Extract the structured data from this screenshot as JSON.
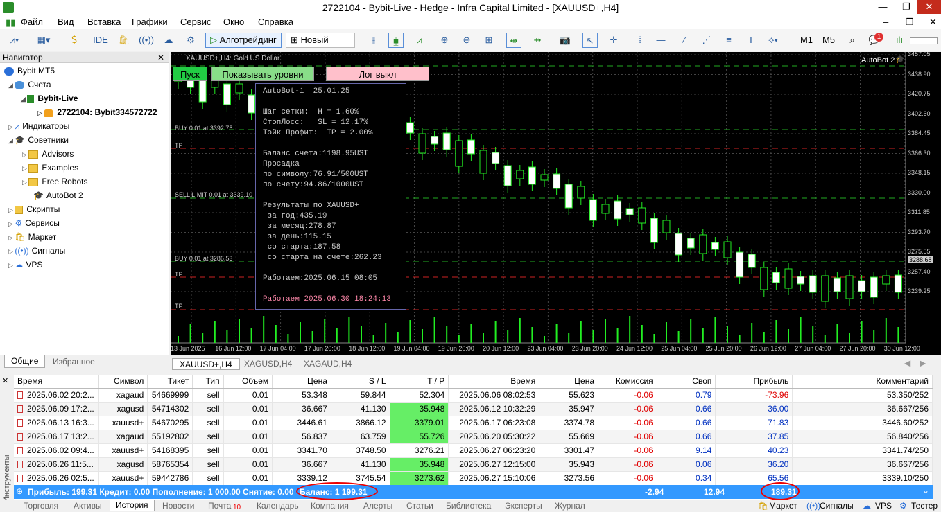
{
  "app": {
    "title": "2722104 - Bybit-Live - Hedge - Infra Capital Limited - [XAUUSD+,H4]"
  },
  "menu": [
    "Файл",
    "Вид",
    "Вставка",
    "Графики",
    "Сервис",
    "Окно",
    "Справка"
  ],
  "toolbar": {
    "ide": "IDE",
    "algo": "Алготрейдинг",
    "new_order": "Новый ордер",
    "m1": "M1",
    "m5": "M5",
    "notif_count": "1"
  },
  "navigator": {
    "title": "Навигатор",
    "root": "Bybit MT5",
    "accounts": "Счета",
    "bybit_live": "Bybit-Live",
    "account": "2722104: Bybit334572722",
    "indicators": "Индикаторы",
    "advisors": "Советники",
    "adv_items": [
      "Advisors",
      "Examples",
      "Free Robots",
      "AutoBot 2"
    ],
    "scripts": "Скрипты",
    "services": "Сервисы",
    "market": "Маркет",
    "signals": "Сигналы",
    "vps": "VPS",
    "tab_general": "Общие",
    "tab_fav": "Избранное"
  },
  "chart": {
    "symbol_desc": "XAUUSD+,H4: Gold US Dollar",
    "autobot": "AutoBot 2",
    "btn_start": "Пуск",
    "btn_levels": "Показывать уровни",
    "btn_log": "Лог выкл",
    "labels": {
      "buy1": "BUY 0.01 at 3392.75",
      "tp": "TP",
      "sell_limit": "SELL LIMIT 0.01 at 3339.10",
      "buy2": "BUY 0.01 at 3286.53"
    },
    "price_ticks": [
      "3457.05",
      "3438.90",
      "3420.75",
      "3402.60",
      "3384.45",
      "3366.30",
      "3348.15",
      "3330.00",
      "3311.85",
      "3293.70",
      "3275.55",
      "3257.40",
      "3239.25"
    ],
    "current_price": "3288.68",
    "time_ticks": [
      "13 Jun 2025",
      "16 Jun 12:00",
      "17 Jun 04:00",
      "17 Jun 20:00",
      "18 Jun 12:00",
      "19 Jun 04:00",
      "19 Jun 20:00",
      "20 Jun 12:00",
      "23 Jun 04:00",
      "23 Jun 20:00",
      "24 Jun 12:00",
      "25 Jun 04:00",
      "25 Jun 20:00",
      "26 Jun 12:00",
      "27 Jun 04:00",
      "27 Jun 20:00",
      "30 Jun 12:00"
    ],
    "tabs": [
      "XAUUSD+,H4",
      "XAGUSD,H4",
      "XAGAUD,H4"
    ],
    "panel": [
      "AutoBot-1  25.01.25",
      "",
      "Шаг сетки:  H = 1.60%",
      "СтопЛосс:   SL = 12.17%",
      "Тэйк Профит:  TP = 2.00%",
      "",
      "Баланс счета:1198.95UST",
      "Просадка",
      "по символу:76.91/500UST",
      "по счету:94.86/1000UST",
      "",
      "Результаты по XAUUSD+",
      " за год:435.19",
      " за месяц:278.87",
      " за день:115.15",
      " со старта:187.58",
      " со старта на счете:262.23",
      "",
      "Работаем:2025.06.15 08:05",
      "",
      "Работаем 2025.06.30 18:24:13"
    ]
  },
  "table": {
    "headers": [
      "Время",
      "Символ",
      "Тикет",
      "Тип",
      "Объем",
      "Цена",
      "S / L",
      "T / P",
      "Время",
      "Цена",
      "Комиссия",
      "Своп",
      "Прибыль",
      "Комментарий"
    ],
    "rows": [
      [
        "2025.06.02 20:2...",
        "xagaud",
        "54669999",
        "sell",
        "0.01",
        "53.348",
        "59.844",
        "52.304",
        "2025.06.06 08:02:53",
        "55.623",
        "-0.06",
        "0.79",
        "-73.96",
        "53.350/252"
      ],
      [
        "2025.06.09 17:2...",
        "xagusd",
        "54714302",
        "sell",
        "0.01",
        "36.667",
        "41.130",
        "35.948",
        "2025.06.12 10:32:29",
        "35.947",
        "-0.06",
        "0.66",
        "36.00",
        "36.667/256"
      ],
      [
        "2025.06.13 16:3...",
        "xauusd+",
        "54670295",
        "sell",
        "0.01",
        "3446.61",
        "3866.12",
        "3379.01",
        "2025.06.17 06:23:08",
        "3374.78",
        "-0.06",
        "0.66",
        "71.83",
        "3446.60/252"
      ],
      [
        "2025.06.17 13:2...",
        "xagaud",
        "55192802",
        "sell",
        "0.01",
        "56.837",
        "63.759",
        "55.726",
        "2025.06.20 05:30:22",
        "55.669",
        "-0.06",
        "0.66",
        "37.85",
        "56.840/256"
      ],
      [
        "2025.06.02 09:4...",
        "xauusd+",
        "54168395",
        "sell",
        "0.01",
        "3341.70",
        "3748.50",
        "3276.21",
        "2025.06.27 06:23:20",
        "3301.47",
        "-0.06",
        "9.14",
        "40.23",
        "3341.74/250"
      ],
      [
        "2025.06.26 11:5...",
        "xagusd",
        "58765354",
        "sell",
        "0.01",
        "36.667",
        "41.130",
        "35.948",
        "2025.06.27 12:15:00",
        "35.943",
        "-0.06",
        "0.06",
        "36.20",
        "36.667/256"
      ],
      [
        "2025.06.26 02:5...",
        "xauusd+",
        "59442786",
        "sell",
        "0.01",
        "3339.12",
        "3745.54",
        "3273.62",
        "2025.06.27 15:10:06",
        "3273.56",
        "-0.06",
        "0.34",
        "65.56",
        "3339.10/250"
      ]
    ],
    "tp_highlight": [
      false,
      true,
      true,
      true,
      false,
      true,
      true
    ]
  },
  "summary": {
    "text": "Прибыль: 199.31  Кредит: 0.00  Пополнение: 1 000.00  Снятие: 0.00",
    "balance": "Баланс: 1 199.31",
    "commission": "-2.94",
    "swap": "12.94",
    "profit": "189.31"
  },
  "sidebar_label": "Инструменты",
  "bottom_tabs": [
    "Торговля",
    "Активы",
    "История",
    "Новости",
    "Почта",
    "Календарь",
    "Компания",
    "Алерты",
    "Статьи",
    "Библиотека",
    "Эксперты",
    "Журнал"
  ],
  "mail_count": "10",
  "bottom_right": [
    "Маркет",
    "Сигналы",
    "VPS",
    "Тестер"
  ]
}
